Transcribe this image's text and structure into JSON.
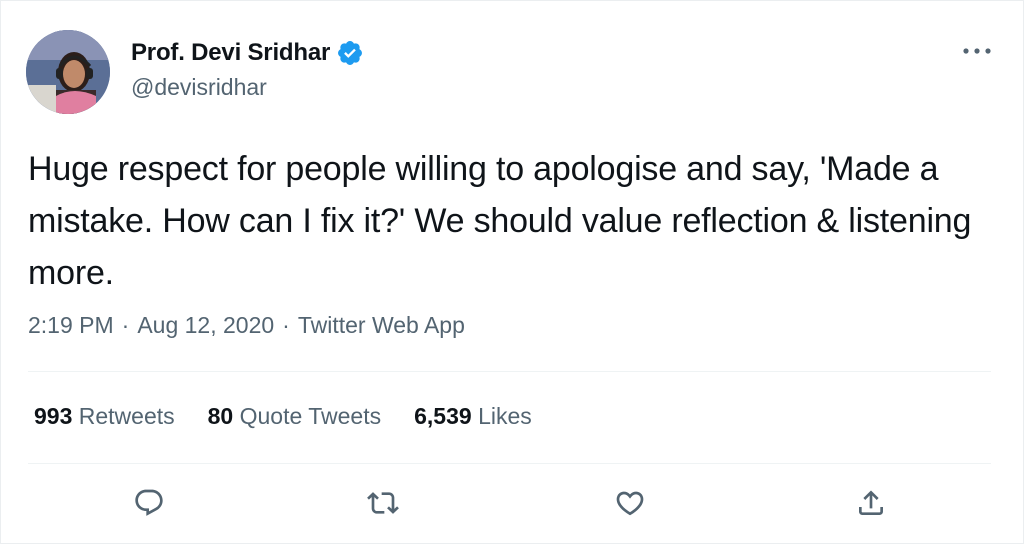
{
  "author": {
    "display_name": "Prof. Devi Sridhar",
    "handle": "@devisridhar",
    "verified": true
  },
  "tweet": {
    "text": "Huge respect for people willing to apologise and say, 'Made a mistake. How can I fix it?' We should value reflection & listening more.",
    "time": "2:19 PM",
    "date": "Aug 12, 2020",
    "source": "Twitter Web App",
    "separator": "·"
  },
  "stats": {
    "retweets_count": "993",
    "retweets_label": "Retweets",
    "quotes_count": "80",
    "quotes_label": "Quote Tweets",
    "likes_count": "6,539",
    "likes_label": "Likes"
  },
  "icons": {
    "more": "more-dots-icon",
    "verified": "verified-badge-icon",
    "reply": "reply-bubble-icon",
    "retweet": "retweet-arrows-icon",
    "like": "heart-icon",
    "share": "share-upload-icon"
  },
  "colors": {
    "text": "#0f1419",
    "secondary": "#536471",
    "verified_blue": "#1d9bf0",
    "divider": "#eff3f4"
  }
}
